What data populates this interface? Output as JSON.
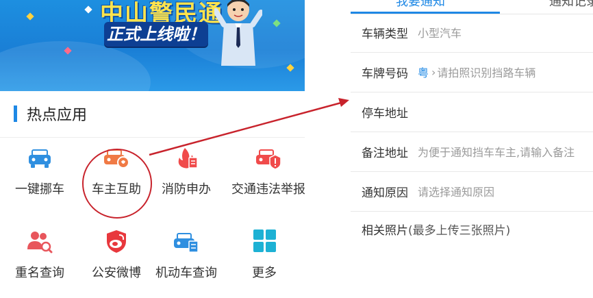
{
  "banner": {
    "title": "中山警民通",
    "subtitle": "正式上线啦！"
  },
  "hot_apps": {
    "section_title": "热点应用",
    "items": [
      {
        "label": "一键挪车",
        "icon": "car-front-icon",
        "color": "#2f8fe0"
      },
      {
        "label": "车主互助",
        "icon": "car-help-icon",
        "color": "#f07a45"
      },
      {
        "label": "消防申办",
        "icon": "fire-document-icon",
        "color": "#f04b4b"
      },
      {
        "label": "交通违法举报",
        "icon": "car-alert-icon",
        "color": "#f04b4b"
      },
      {
        "label": "重名查询",
        "icon": "people-search-icon",
        "color": "#e8565c"
      },
      {
        "label": "公安微博",
        "icon": "weibo-icon",
        "color": "#e8383d"
      },
      {
        "label": "机动车查询",
        "icon": "car-document-icon",
        "color": "#2f8fe0"
      },
      {
        "label": "更多",
        "icon": "grid-more-icon",
        "color": "#1db1d4"
      }
    ]
  },
  "form": {
    "tabs": [
      "我要通知",
      "通知记录"
    ],
    "rows": [
      {
        "label": "车辆类型",
        "value": "小型汽车"
      },
      {
        "label": "车牌号码",
        "province": "粤",
        "placeholder": "请拍照识别挡路车辆"
      },
      {
        "label": "停车地址",
        "value": ""
      },
      {
        "label": "备注地址",
        "value": "为便于通知挡车车主,请输入备注"
      },
      {
        "label": "通知原因",
        "value": "请选择通知原因"
      }
    ],
    "photos_label": "相关照片",
    "photos_hint": "(最多上传三张照片)"
  },
  "colors": {
    "accent": "#1e88e5",
    "highlight_circle": "#c8232c"
  }
}
